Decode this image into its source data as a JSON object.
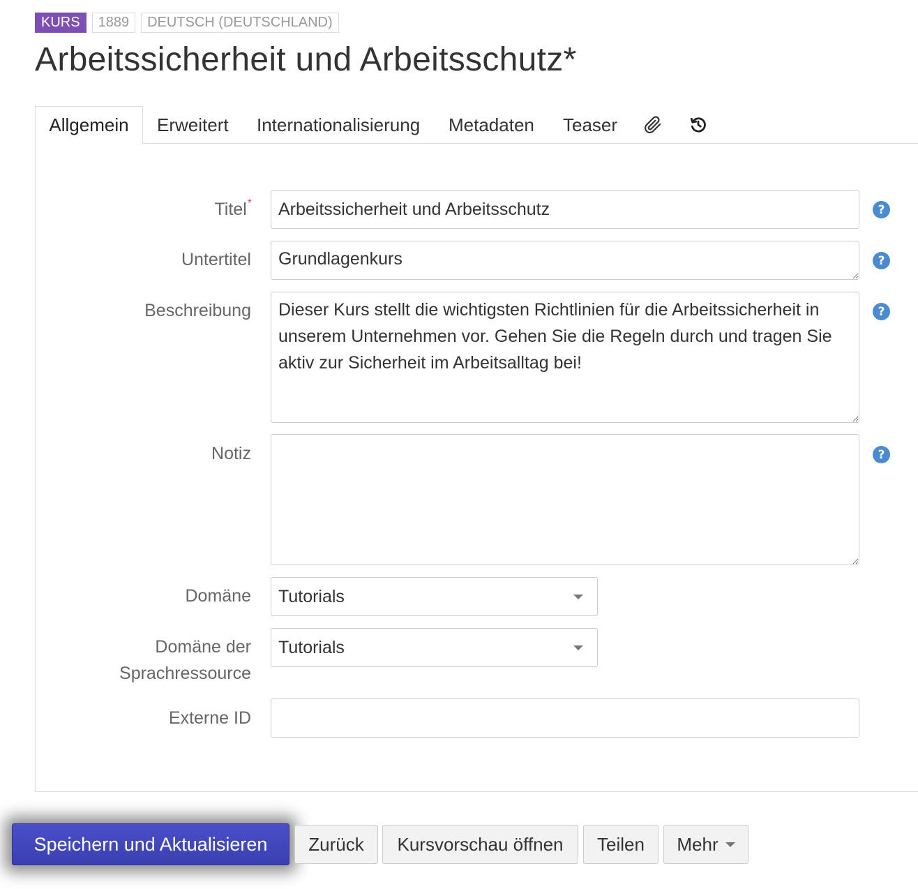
{
  "header": {
    "badges": {
      "type": "KURS",
      "id": "1889",
      "language": "DEUTSCH (DEUTSCHLAND)"
    },
    "title": "Arbeitssicherheit und Arbeitsschutz*"
  },
  "tabs": {
    "general": "Allgemein",
    "advanced": "Erweitert",
    "internationalization": "Internationalisierung",
    "metadata": "Metadaten",
    "teaser": "Teaser",
    "attachments_icon": "paperclip-icon",
    "history_icon": "history-icon"
  },
  "form": {
    "title": {
      "label": "Titel",
      "required_mark": "*",
      "value": "Arbeitssicherheit und Arbeitsschutz"
    },
    "subtitle": {
      "label": "Untertitel",
      "value": "Grundlagenkurs"
    },
    "description": {
      "label": "Beschreibung",
      "value": "Dieser Kurs stellt die wichtigsten Richtlinien für die Arbeitssicherheit in unserem Unternehmen vor. Gehen Sie die Regeln durch und tragen Sie aktiv zur Sicherheit im Arbeitsalltag bei!"
    },
    "note": {
      "label": "Notiz",
      "value": ""
    },
    "domain": {
      "label": "Domäne",
      "value": "Tutorials"
    },
    "language_domain": {
      "label_line1": "Domäne der",
      "label_line2": "Sprachressource",
      "value": "Tutorials"
    },
    "external_id": {
      "label": "Externe ID",
      "value": ""
    },
    "help_glyph": "?"
  },
  "actions": {
    "save": "Speichern und Aktualisieren",
    "back": "Zurück",
    "preview": "Kursvorschau öffnen",
    "share": "Teilen",
    "more": "Mehr"
  },
  "colors": {
    "badge_primary": "#7e4fb3",
    "primary_button": "#3f44b8",
    "help_icon": "#4a8ad0",
    "required": "#d9534f"
  }
}
